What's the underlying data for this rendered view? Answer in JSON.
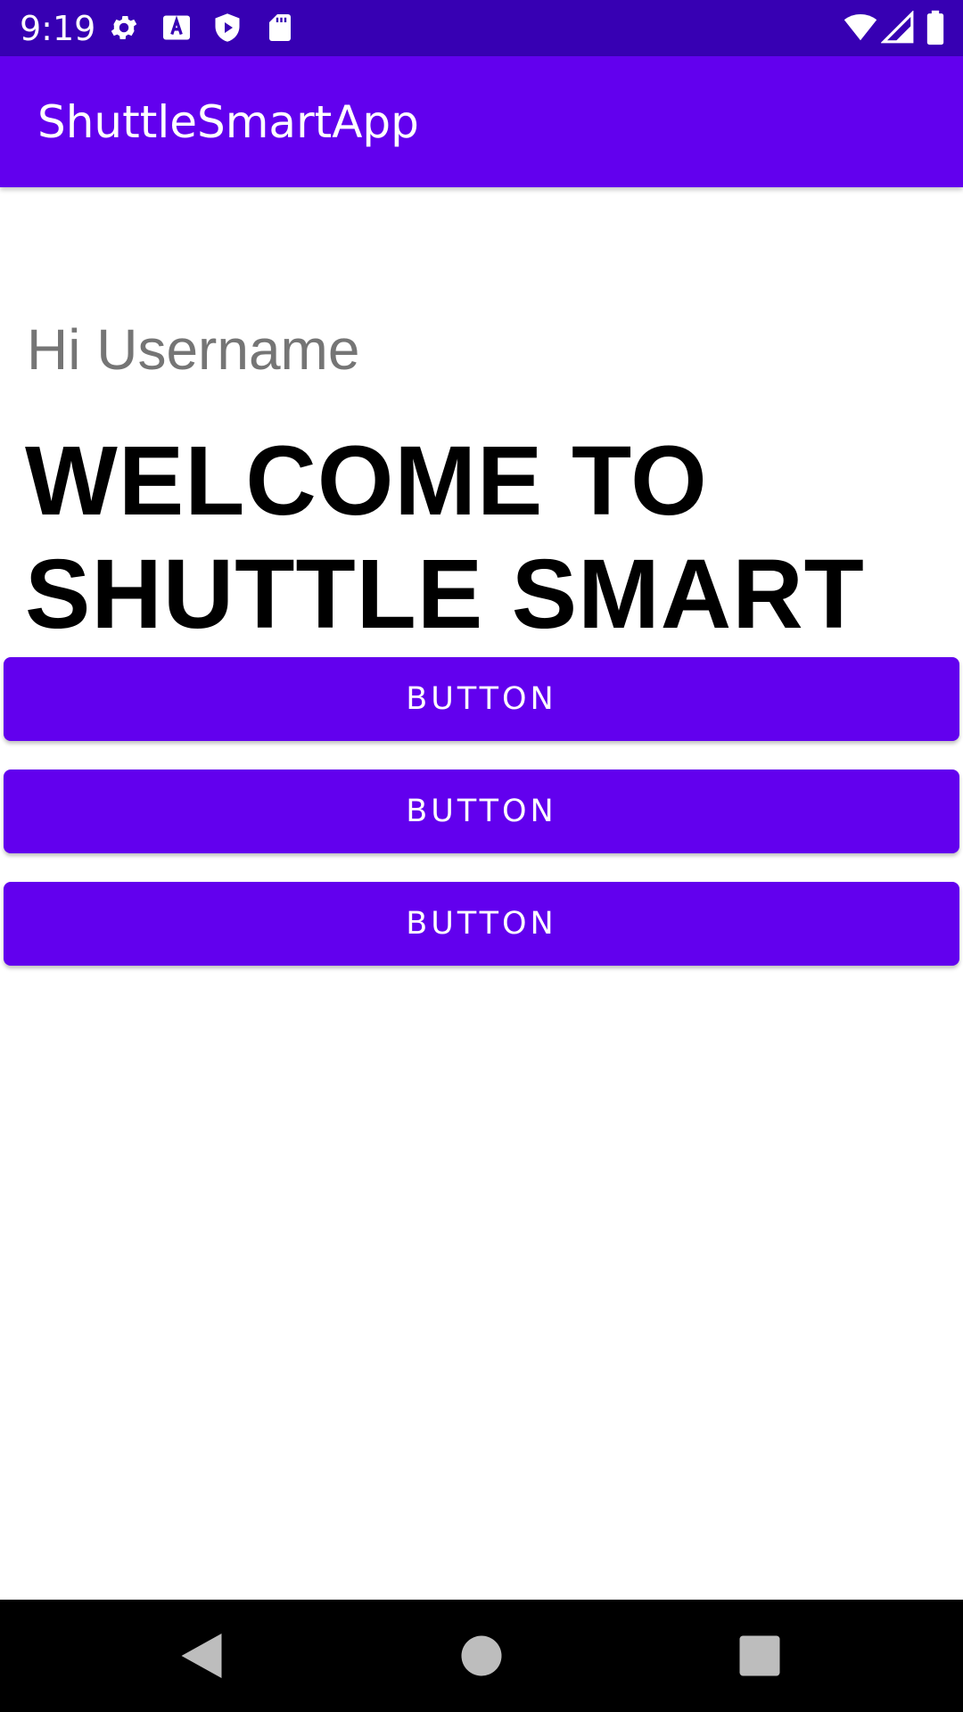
{
  "status_bar": {
    "time": "9:19",
    "icons": [
      "settings-icon",
      "text-a-icon",
      "play-shield-icon",
      "sd-card-icon",
      "wifi-icon",
      "signal-icon",
      "battery-icon"
    ]
  },
  "app_bar": {
    "title": "ShuttleSmartApp"
  },
  "main": {
    "greeting": "Hi Username",
    "welcome": "WELCOME TO SHUTTLE SMART",
    "buttons": [
      {
        "label": "BUTTON"
      },
      {
        "label": "BUTTON"
      },
      {
        "label": "BUTTON"
      }
    ]
  },
  "nav_bar": {
    "icons": [
      "back-icon",
      "home-icon",
      "recents-icon"
    ]
  },
  "colors": {
    "status_bar": "#3700B3",
    "primary": "#6200EE",
    "greeting_text": "#757575",
    "nav_bar": "#000000"
  }
}
